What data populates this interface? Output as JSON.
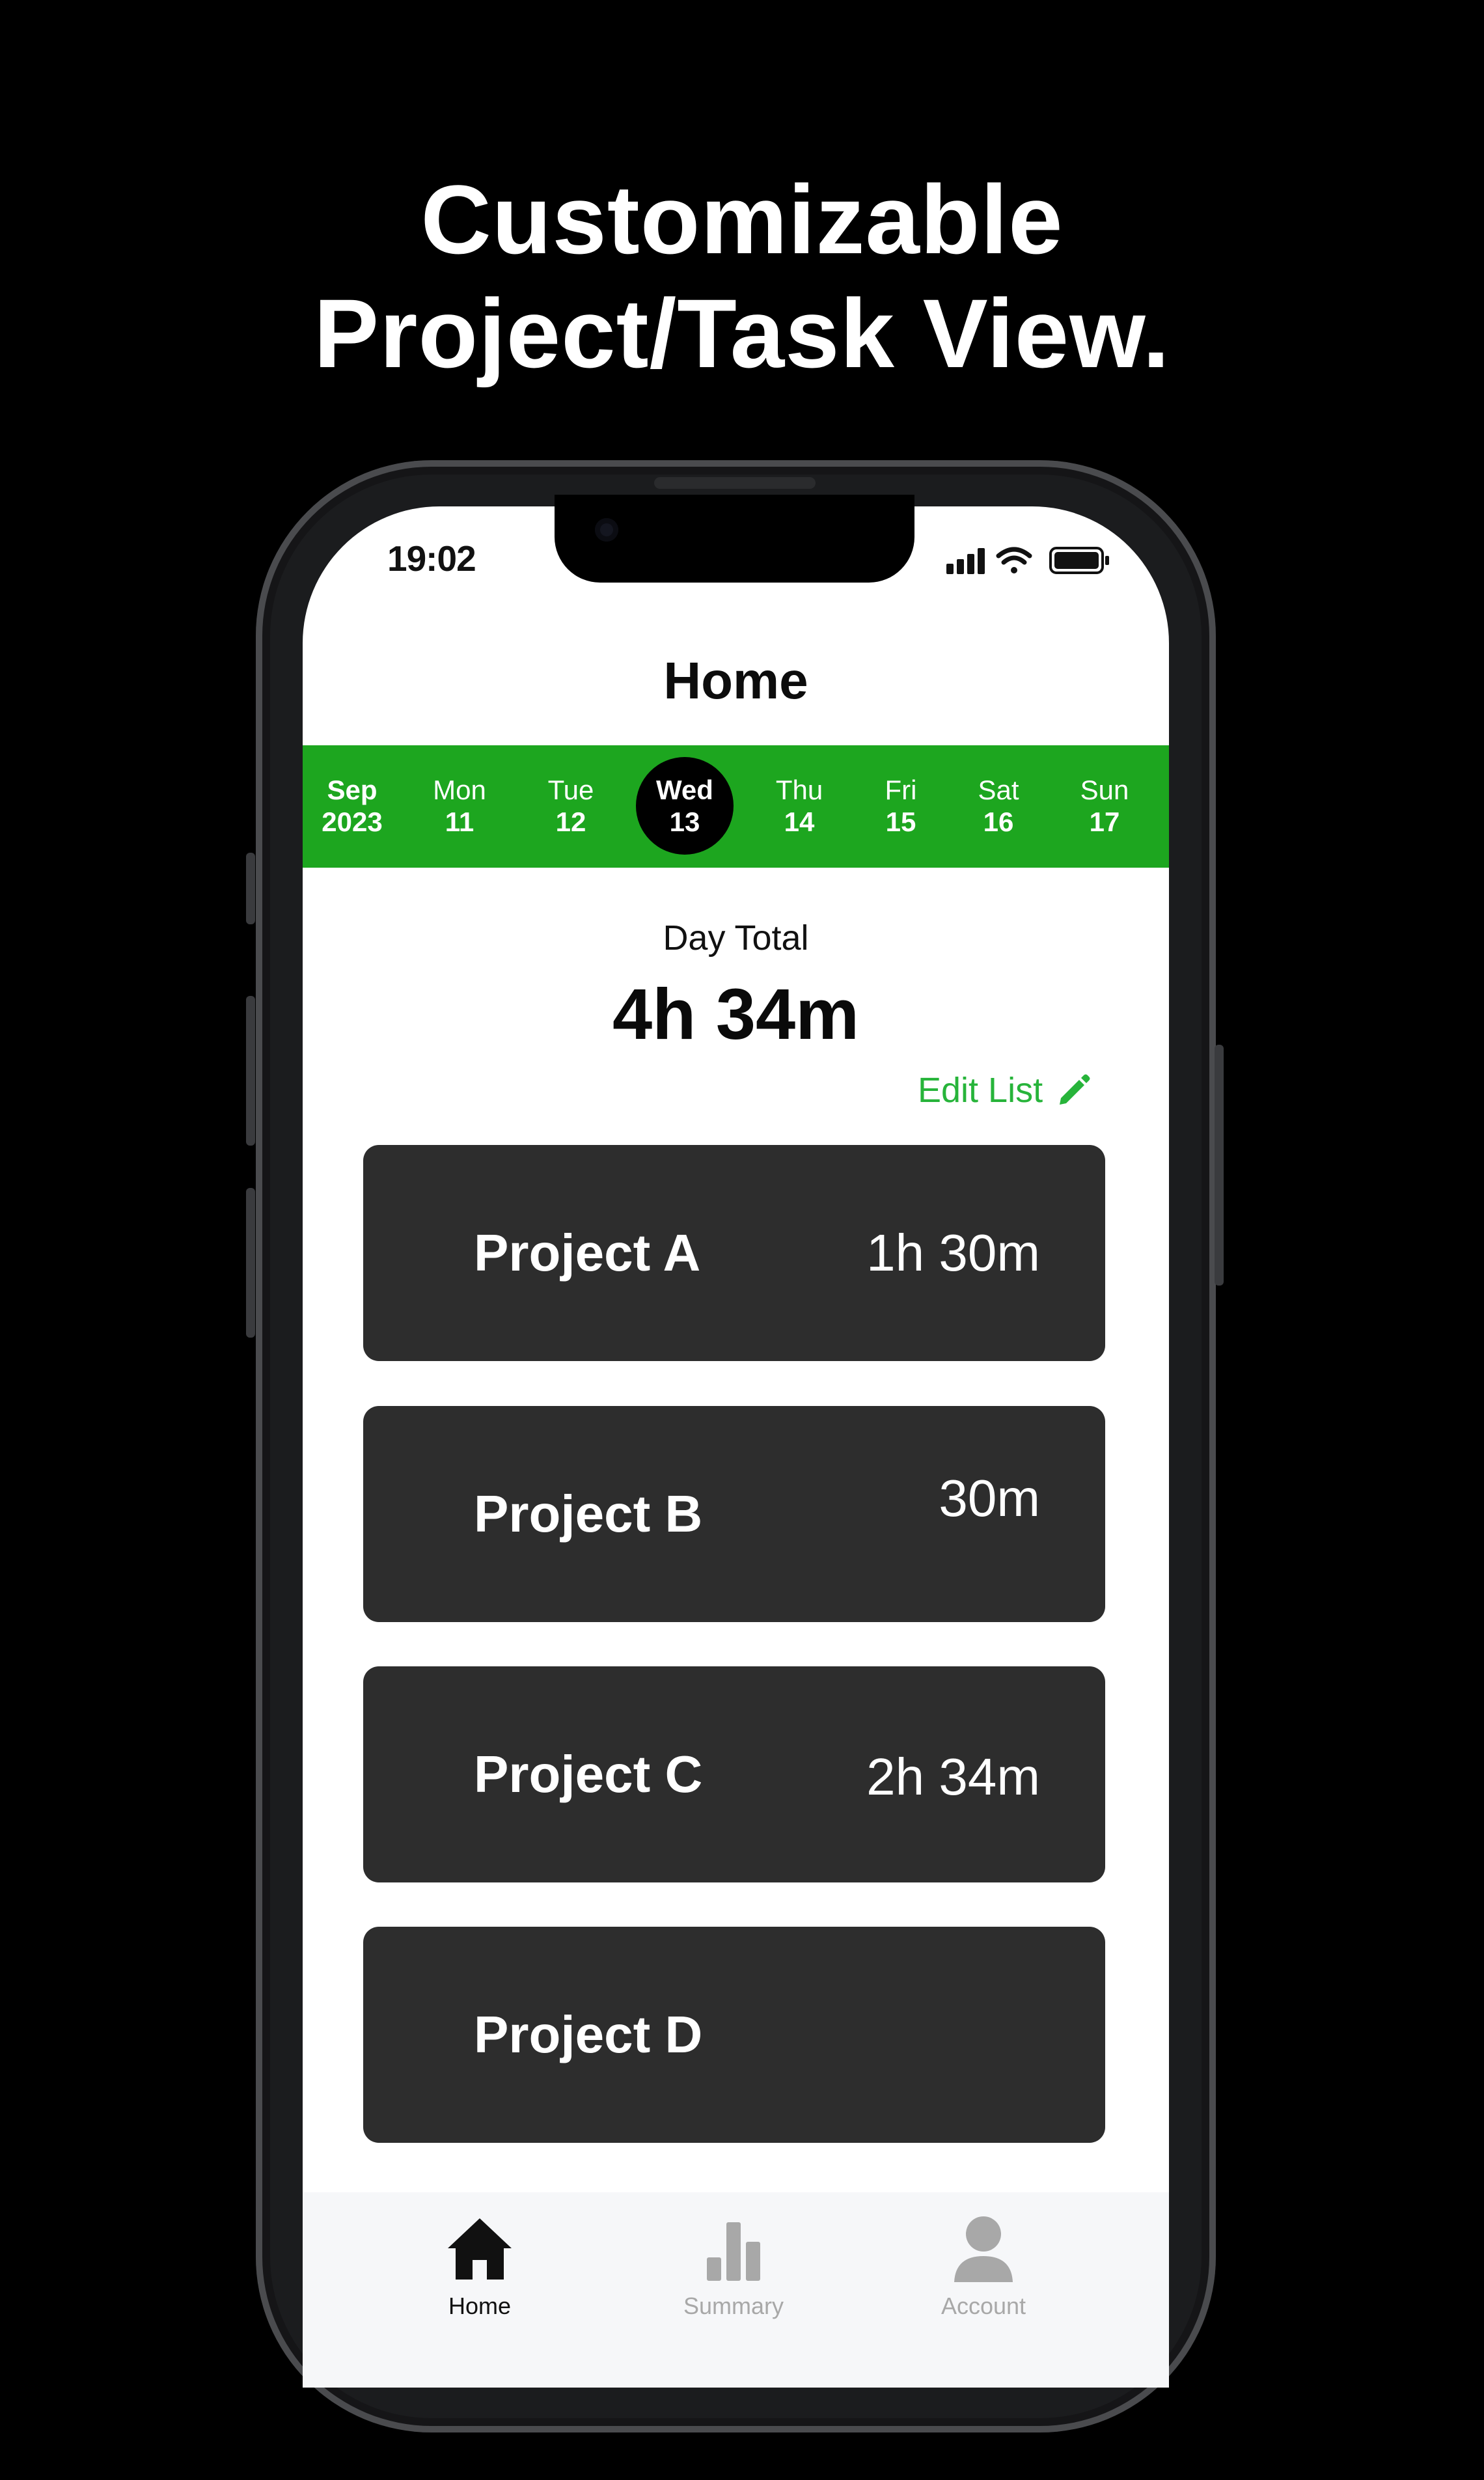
{
  "headline": {
    "line1": "Customizable",
    "line2": "Project/Task View."
  },
  "status_bar": {
    "time": "19:02",
    "icons": [
      "cellular-signal-icon",
      "wifi-icon",
      "battery-icon"
    ]
  },
  "header": {
    "title": "Home"
  },
  "date_strip": {
    "month": "Sep",
    "year": "2023",
    "days": [
      {
        "name": "Mon",
        "date": "11"
      },
      {
        "name": "Tue",
        "date": "12"
      },
      {
        "name": "Wed",
        "date": "13",
        "selected": true
      },
      {
        "name": "Thu",
        "date": "14"
      },
      {
        "name": "Fri",
        "date": "15"
      },
      {
        "name": "Sat",
        "date": "16"
      },
      {
        "name": "Sun",
        "date": "17"
      }
    ]
  },
  "day_total": {
    "label": "Day Total",
    "value": "4h 34m"
  },
  "edit_list": {
    "label": "Edit List",
    "icon": "pencil-icon"
  },
  "projects": [
    {
      "name": "Project A",
      "time": "1h 30m"
    },
    {
      "name": "Project B",
      "time": "30m"
    },
    {
      "name": "Project C",
      "time": "2h 34m"
    },
    {
      "name": "Project D",
      "time": ""
    }
  ],
  "tab_bar": {
    "tabs": [
      {
        "label": "Home",
        "icon": "home-icon",
        "active": true
      },
      {
        "label": "Summary",
        "icon": "bar-chart-icon",
        "active": false
      },
      {
        "label": "Account",
        "icon": "person-icon",
        "active": false
      }
    ]
  },
  "colors": {
    "background": "#000000",
    "accent_green": "#1da61f",
    "edit_green": "#27b43a",
    "card": "#2d2d2d",
    "tab_active": "#111111",
    "tab_inactive": "#a8a8a8"
  }
}
